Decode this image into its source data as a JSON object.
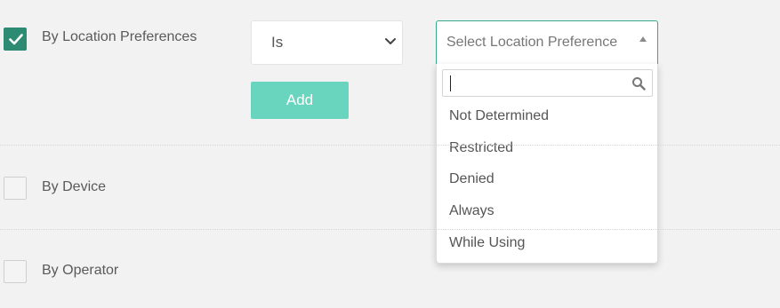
{
  "filters": {
    "location": {
      "label": "By Location Preferences",
      "checked": true,
      "operator_value": "Is",
      "add_label": "Add",
      "select_placeholder": "Select Location Preference",
      "dropdown": {
        "search_value": "",
        "options": [
          "Not Determined",
          "Restricted",
          "Denied",
          "Always",
          "While Using"
        ]
      }
    },
    "device": {
      "label": "By Device",
      "checked": false
    },
    "operator": {
      "label": "By Operator",
      "checked": false
    }
  },
  "colors": {
    "accent": "#2e8b73",
    "add_button": "#6ad5be",
    "select_border": "#3aa88c"
  }
}
